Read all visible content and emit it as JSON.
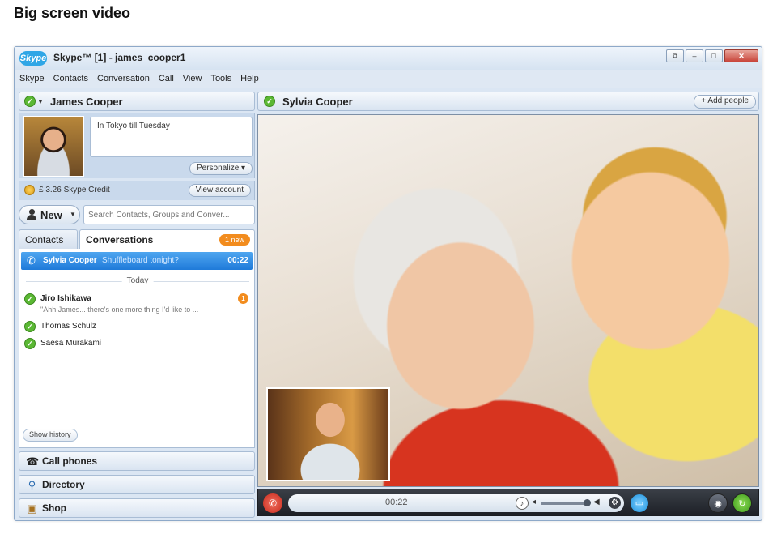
{
  "page": {
    "title": "Big screen video"
  },
  "window": {
    "logo_text": "Skype",
    "title": "Skype™ [1] - james_cooper1",
    "controls": {
      "restore": "⧉",
      "minimize": "–",
      "maximize": "□",
      "close": "✕"
    }
  },
  "menu": [
    "Skype",
    "Contacts",
    "Conversation",
    "Call",
    "View",
    "Tools",
    "Help"
  ],
  "profile": {
    "name": "James Cooper",
    "status": "online",
    "mood": "In Tokyo till Tuesday",
    "personalize_label": "Personalize ▾",
    "credit": "£ 3.26 Skype Credit",
    "view_account_label": "View account"
  },
  "toolbar": {
    "new_label": "New",
    "search_placeholder": "Search Contacts, Groups and Conver..."
  },
  "tabs": {
    "contacts": "Contacts",
    "conversations": "Conversations",
    "new_badge": "1 new"
  },
  "conversations": {
    "active": {
      "name": "Sylvia Cooper",
      "message": "Shuffleboard tonight?",
      "time": "00:22"
    },
    "divider": "Today",
    "items": [
      {
        "name": "Jiro Ishikawa",
        "preview": "\"Ahh James... there's one more thing I'd like to ...",
        "unread": "1"
      },
      {
        "name": "Thomas Schulz"
      },
      {
        "name": "Saesa Murakami"
      }
    ],
    "show_history_label": "Show history"
  },
  "bottom_nav": {
    "call_phones": "Call phones",
    "directory": "Directory",
    "shop": "Shop"
  },
  "call": {
    "contact_name": "Sylvia Cooper",
    "add_people_label": "+ Add people",
    "timer": "00:22"
  },
  "colors": {
    "accent": "#1f7ad9",
    "online": "#5bb834",
    "badge": "#f28c1e",
    "hangup": "#c8281a"
  }
}
